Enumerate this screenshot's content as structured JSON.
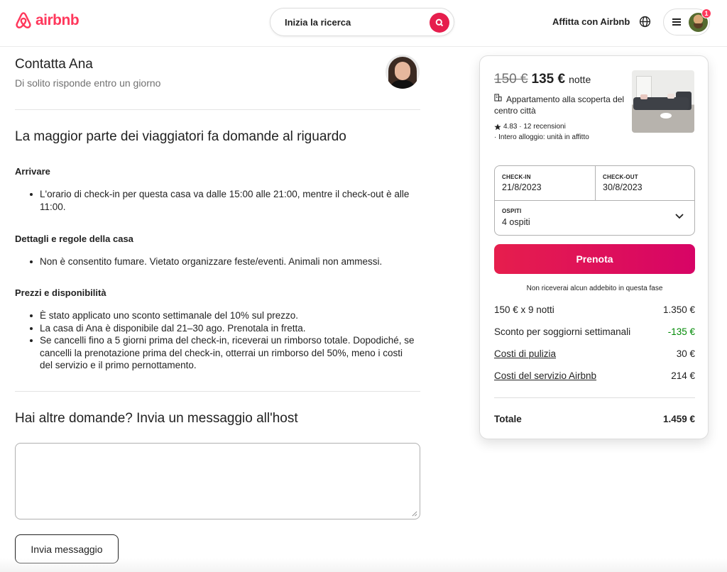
{
  "header": {
    "logo_text": "airbnb",
    "search_label": "Inizia la ricerca",
    "host_link": "Affitta con Airbnb",
    "notification_count": "1"
  },
  "host": {
    "title": "Contatta Ana",
    "subtitle": "Di solito risponde entro un giorno"
  },
  "faq": {
    "title": "La maggior parte dei viaggiatori fa domande al riguardo",
    "sections": [
      {
        "title": "Arrivare",
        "items": [
          "L'orario di check-in per questa casa va dalle 15:00 alle 21:00, mentre il check-out è alle 11:00."
        ]
      },
      {
        "title": "Dettagli e regole della casa",
        "items": [
          "Non è consentito fumare. Vietato organizzare feste/eventi. Animali non ammessi."
        ]
      },
      {
        "title": "Prezzi e disponibilità",
        "items": [
          "È stato applicato uno sconto settimanale del 10% sul prezzo.",
          "La casa di Ana è disponibile dal 21–30 ago. Prenotala in fretta.",
          "Se cancelli fino a 5 giorni prima del check-in, riceverai un rimborso totale. Dopodiché, se cancelli la prenotazione prima del check-in, otterrai un rimborso del 50%, meno i costi del servizio e il primo pernottamento."
        ]
      }
    ]
  },
  "message": {
    "title": "Hai altre domande? Invia un messaggio all'host",
    "value": "",
    "send_label": "Invia messaggio"
  },
  "booking": {
    "old_price": "150 €",
    "new_price": "135 €",
    "per_night": "notte",
    "listing_name": "Appartamento alla scoperta del centro città",
    "rating": "4.83 · 12 recensioni",
    "listing_type": "· Intero alloggio: unità in affitto",
    "checkin_label": "CHECK-IN",
    "checkin_value": "21/8/2023",
    "checkout_label": "CHECK-OUT",
    "checkout_value": "30/8/2023",
    "guests_label": "OSPITI",
    "guests_value": "4 ospiti",
    "book_label": "Prenota",
    "no_charge": "Non riceverai alcun addebito in questa fase",
    "lines": [
      {
        "label": "150 € x 9 notti",
        "amount": "1.350 €"
      },
      {
        "label": "Sconto per soggiorni settimanali",
        "amount": "-135 €"
      },
      {
        "label": "Costi di pulizia",
        "amount": "30 €"
      },
      {
        "label": "Costi del servizio Airbnb",
        "amount": "214 €"
      }
    ],
    "total_label": "Totale",
    "total_amount": "1.459 €"
  },
  "colors": {
    "brand": "#ff385c",
    "discount": "#008a05"
  }
}
